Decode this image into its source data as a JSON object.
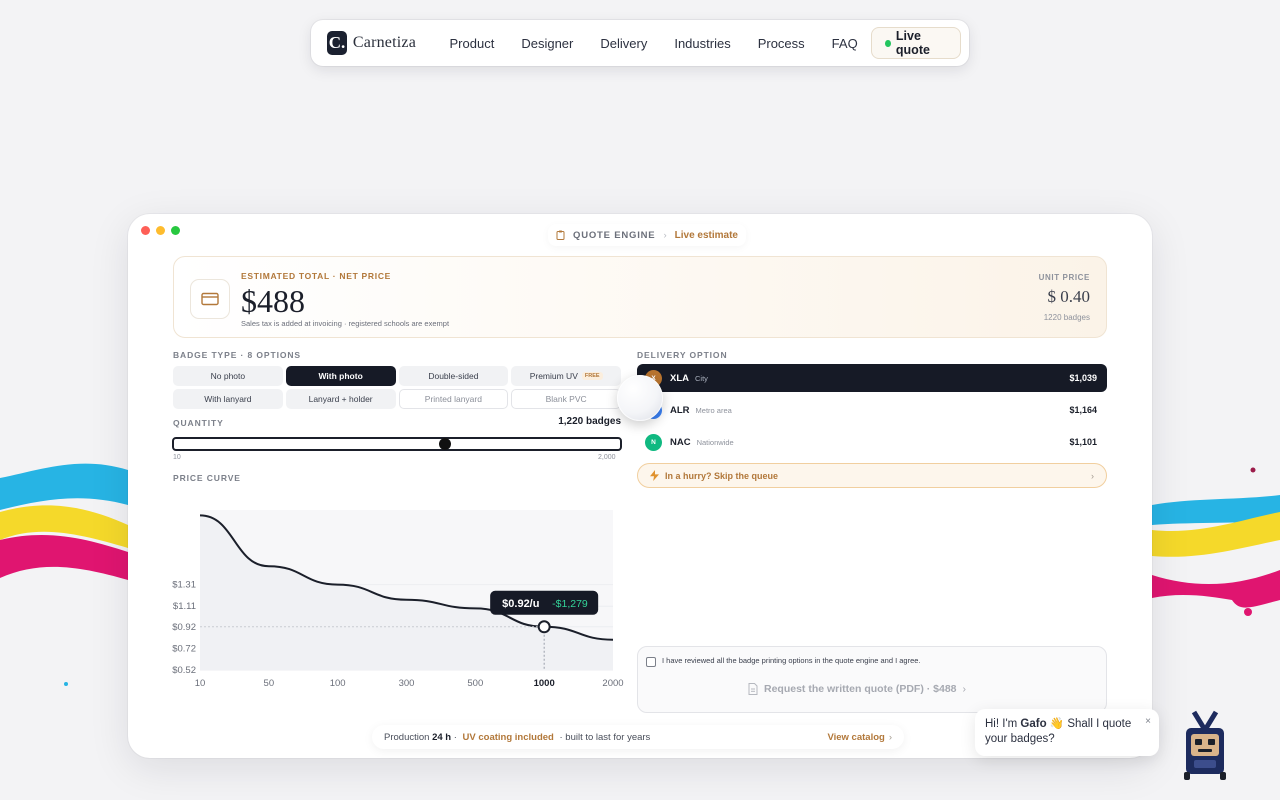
{
  "nav": {
    "logo_letter": "C.",
    "logo_text": "Carnetiza",
    "links": [
      "Product",
      "Designer",
      "Delivery",
      "Industries",
      "Process",
      "FAQ"
    ],
    "cta": "Live quote"
  },
  "breadcrumb": {
    "section": "QUOTE ENGINE",
    "current": "Live estimate"
  },
  "estimate": {
    "label": "ESTIMATED TOTAL · NET PRICE",
    "total": "$488",
    "note": "Sales tax is added at invoicing · registered schools are exempt",
    "unit_label": "UNIT PRICE",
    "unit_price": "$ 0.40",
    "unit_count": "1220 badges"
  },
  "badge_type": {
    "label": "BADGE TYPE · 8 OPTIONS",
    "options": [
      {
        "label": "No photo"
      },
      {
        "label": "With photo",
        "selected": true
      },
      {
        "label": "Double-sided"
      },
      {
        "label": "Premium UV",
        "tag": "FREE"
      },
      {
        "label": "With lanyard"
      },
      {
        "label": "Lanyard + holder"
      },
      {
        "label": "Printed lanyard"
      },
      {
        "label": "Blank PVC"
      }
    ]
  },
  "quantity": {
    "label": "QUANTITY",
    "value_text": "1,220 badges",
    "min": "10",
    "max": "2,000",
    "value": 1220,
    "min_value": 10,
    "max_value": 2000
  },
  "price_curve": {
    "label": "PRICE CURVE",
    "tooltip_price": "$0.92/u",
    "tooltip_saving": "-$1,279"
  },
  "chart_data": {
    "type": "line",
    "title": "PRICE CURVE",
    "x_ticks": [
      "10",
      "50",
      "100",
      "300",
      "500",
      "1000",
      "2000"
    ],
    "y_ticks": [
      "$1.31",
      "$1.11",
      "$0.92",
      "$0.72",
      "$0.52"
    ],
    "series": [
      {
        "x": [
          "10",
          "50",
          "100",
          "300",
          "500",
          "1000",
          "2000"
        ],
        "values": [
          1.95,
          1.48,
          1.31,
          1.17,
          1.09,
          0.92,
          0.8
        ]
      }
    ],
    "highlight": {
      "x": "1000",
      "y": 0.92
    },
    "ylim": [
      0.52,
      2.0
    ]
  },
  "delivery": {
    "label": "DELIVERY OPTION",
    "options": [
      {
        "icon": "X",
        "code": "XLA",
        "name": "City",
        "price": "$1,039",
        "color": "#b8742f",
        "selected": true
      },
      {
        "icon": "A",
        "code": "ALR",
        "name": "Metro area",
        "price": "$1,164",
        "color": "#3b82f6"
      },
      {
        "icon": "N",
        "code": "NAC",
        "name": "Nationwide",
        "price": "$1,101",
        "color": "#10b981"
      }
    ],
    "hurry": "In a hurry? Skip the queue"
  },
  "confirm": {
    "text": "I have reviewed all the badge printing options in the quote engine and I agree.",
    "button": "Request the written quote (PDF) · $488"
  },
  "footer": {
    "prefix": "Production",
    "hours": "24 h",
    "mid": " · ",
    "uv": "UV coating included",
    "suffix": " · built to last for years",
    "link": "View catalog"
  },
  "chat": {
    "pre": "Hi! I'm ",
    "name": "Gafo",
    "post": " 👋 Shall I quote your badges?"
  },
  "colors": {
    "accent": "#b2783a",
    "dark": "#161a26",
    "green": "#22c55e"
  }
}
